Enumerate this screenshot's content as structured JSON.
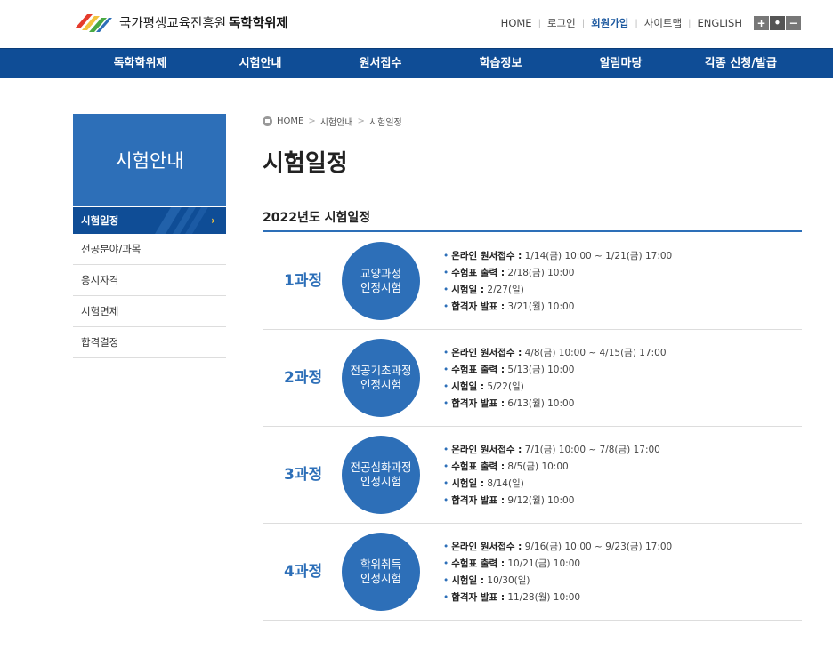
{
  "header": {
    "org": "국가평생교육진흥원",
    "site": "독학학위제",
    "util": [
      "HOME",
      "로그인",
      "회원가입",
      "사이트맵",
      "ENGLISH"
    ],
    "zoom": [
      "+",
      "•",
      "−"
    ]
  },
  "gnb": [
    "독학학위제",
    "시험안내",
    "원서접수",
    "학습정보",
    "알림마당",
    "각종 신청/발급"
  ],
  "lnb": {
    "title": "시험안내",
    "items": [
      "시험일정",
      "전공분야/과목",
      "응시자격",
      "시험면제",
      "합격결정"
    ]
  },
  "breadcrumb": [
    "HOME",
    "시험안내",
    "시험일정"
  ],
  "page_title": "시험일정",
  "year_title": "2022년도 시험일정",
  "courses": [
    {
      "name": "1과정",
      "circle": "교양과정\n인정시험",
      "items": [
        {
          "label": "온라인 원서접수 :",
          "value": " 1/14(금) 10:00 ~ 1/21(금) 17:00"
        },
        {
          "label": "수험표 출력 :",
          "value": " 2/18(금) 10:00"
        },
        {
          "label": "시험일 :",
          "value": " 2/27(일)"
        },
        {
          "label": "합격자 발표 :",
          "value": " 3/21(월) 10:00"
        }
      ]
    },
    {
      "name": "2과정",
      "circle": "전공기초과정\n인정시험",
      "items": [
        {
          "label": "온라인 원서접수 :",
          "value": " 4/8(금) 10:00 ~ 4/15(금) 17:00"
        },
        {
          "label": "수험표 출력 :",
          "value": " 5/13(금) 10:00"
        },
        {
          "label": "시험일 :",
          "value": " 5/22(일)"
        },
        {
          "label": "합격자 발표 :",
          "value": " 6/13(월) 10:00"
        }
      ]
    },
    {
      "name": "3과정",
      "circle": "전공심화과정\n인정시험",
      "items": [
        {
          "label": "온라인 원서접수 :",
          "value": " 7/1(금) 10:00 ~ 7/8(금) 17:00"
        },
        {
          "label": "수험표 출력 :",
          "value": " 8/5(금) 10:00"
        },
        {
          "label": "시험일 :",
          "value": " 8/14(일)"
        },
        {
          "label": "합격자 발표 :",
          "value": " 9/12(월) 10:00"
        }
      ]
    },
    {
      "name": "4과정",
      "circle": "학위취득\n인정시험",
      "items": [
        {
          "label": "온라인 원서접수 :",
          "value": " 9/16(금) 10:00 ~ 9/23(금) 17:00"
        },
        {
          "label": "수험표 출력 :",
          "value": " 10/21(금) 10:00"
        },
        {
          "label": "시험일 :",
          "value": " 10/30(일)"
        },
        {
          "label": "합격자 발표 :",
          "value": " 11/28(월) 10:00"
        }
      ]
    }
  ],
  "colors": {
    "primary": "#0f4d96",
    "accent": "#2d6fb8",
    "highlight": "#f3c23d"
  },
  "icons": [
    "logo-stripes",
    "home-icon",
    "chevron-right-icon"
  ]
}
